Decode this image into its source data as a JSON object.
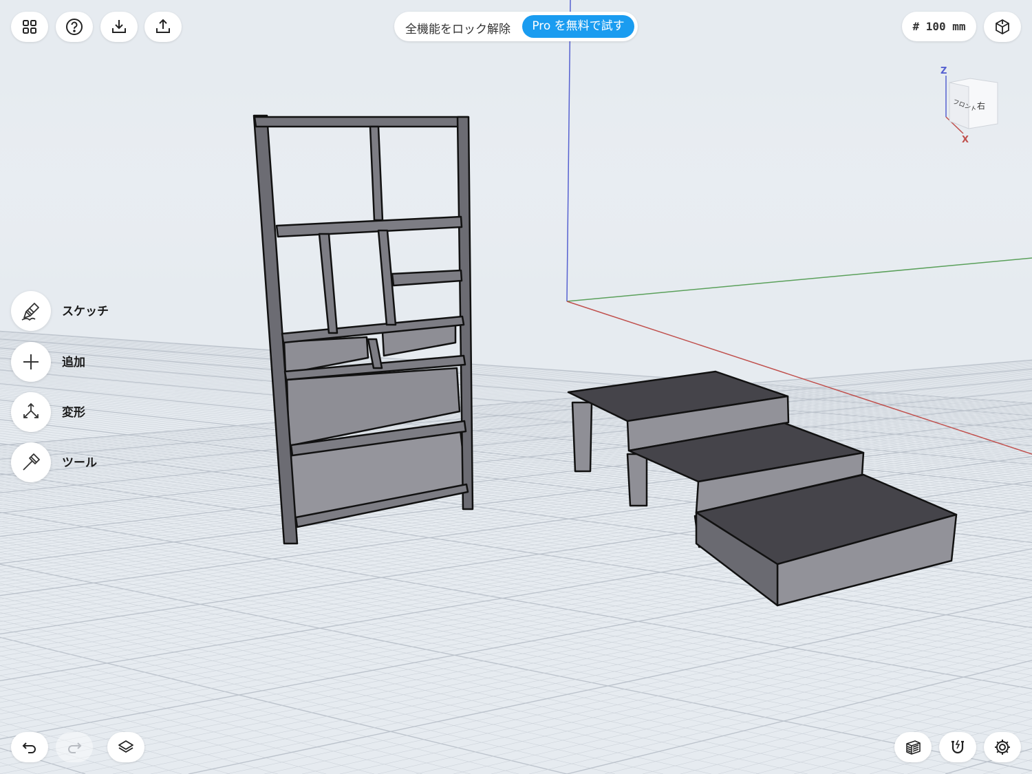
{
  "toolbar_left": [
    {
      "name": "grid-menu-button",
      "icon": "grid-icon"
    },
    {
      "name": "help-button",
      "icon": "help-icon"
    },
    {
      "name": "import-button",
      "icon": "download-icon"
    },
    {
      "name": "export-button",
      "icon": "share-icon"
    }
  ],
  "promo": {
    "text": "全機能をロック解除",
    "cta": "Pro を無料で試す",
    "accent": "#1a9cf0"
  },
  "grid_size": "# 100 mm",
  "viewcube": {
    "axis_z": "Z",
    "axis_x": "X",
    "face_front": "フロント",
    "face_right": "右",
    "icon": "view-cube-icon"
  },
  "side_tools": [
    {
      "label": "スケッチ",
      "icon": "pen-icon"
    },
    {
      "label": "追加",
      "icon": "plus-icon"
    },
    {
      "label": "変形",
      "icon": "transform-icon"
    },
    {
      "label": "ツール",
      "icon": "hammer-icon"
    }
  ],
  "bottom_left": [
    {
      "name": "undo-button",
      "icon": "undo-icon",
      "enabled": true
    },
    {
      "name": "redo-button",
      "icon": "redo-icon",
      "enabled": false
    },
    {
      "name": "layers-button",
      "icon": "layers-icon",
      "enabled": true
    }
  ],
  "bottom_right": [
    {
      "name": "render-mode-button",
      "icon": "hatched-cube-icon"
    },
    {
      "name": "snap-button",
      "icon": "magnet-icon"
    },
    {
      "name": "settings-button",
      "icon": "gear-icon"
    }
  ],
  "colors": {
    "background": "#e6ebf0",
    "axis_x": "#c0504d",
    "axis_y": "#5aa05a",
    "axis_z": "#5560d0",
    "shelf_face": "#8f8f96",
    "step_top": "#45444a"
  }
}
